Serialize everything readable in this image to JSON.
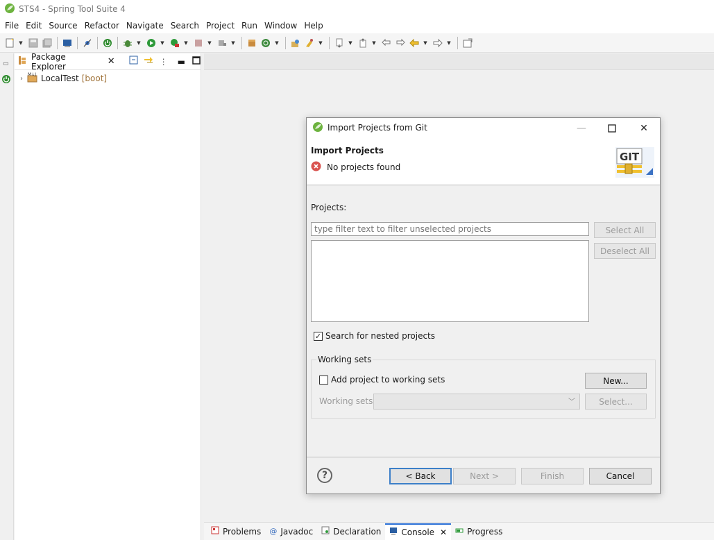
{
  "window": {
    "title": "STS4 - Spring Tool Suite 4"
  },
  "menu": [
    "File",
    "Edit",
    "Source",
    "Refactor",
    "Navigate",
    "Search",
    "Project",
    "Run",
    "Window",
    "Help"
  ],
  "package_explorer": {
    "tab_label": "Package Explorer",
    "items": [
      {
        "label": "LocalTest",
        "decoration": "[boot]"
      }
    ]
  },
  "bottom_tabs": [
    "Problems",
    "Javadoc",
    "Declaration",
    "Console",
    "Progress"
  ],
  "dialog": {
    "title": "Import Projects from Git",
    "header_title": "Import Projects",
    "header_message": "No projects found",
    "logo_text": "GIT",
    "projects_label": "Projects:",
    "filter_placeholder": "type filter text to filter unselected projects",
    "select_all": "Select All",
    "deselect_all": "Deselect All",
    "nested_label": "Search for nested projects",
    "nested_checked": true,
    "working_sets_group": "Working sets",
    "add_to_ws_label": "Add project to working sets",
    "add_to_ws_checked": false,
    "new_button": "New...",
    "working_sets_label": "Working sets:",
    "select_button": "Select...",
    "back_button": "< Back",
    "next_button": "Next >",
    "finish_button": "Finish",
    "cancel_button": "Cancel"
  },
  "colors": {
    "accent": "#2a6fd6",
    "error": "#d9534f",
    "spring_green": "#6db33f"
  }
}
